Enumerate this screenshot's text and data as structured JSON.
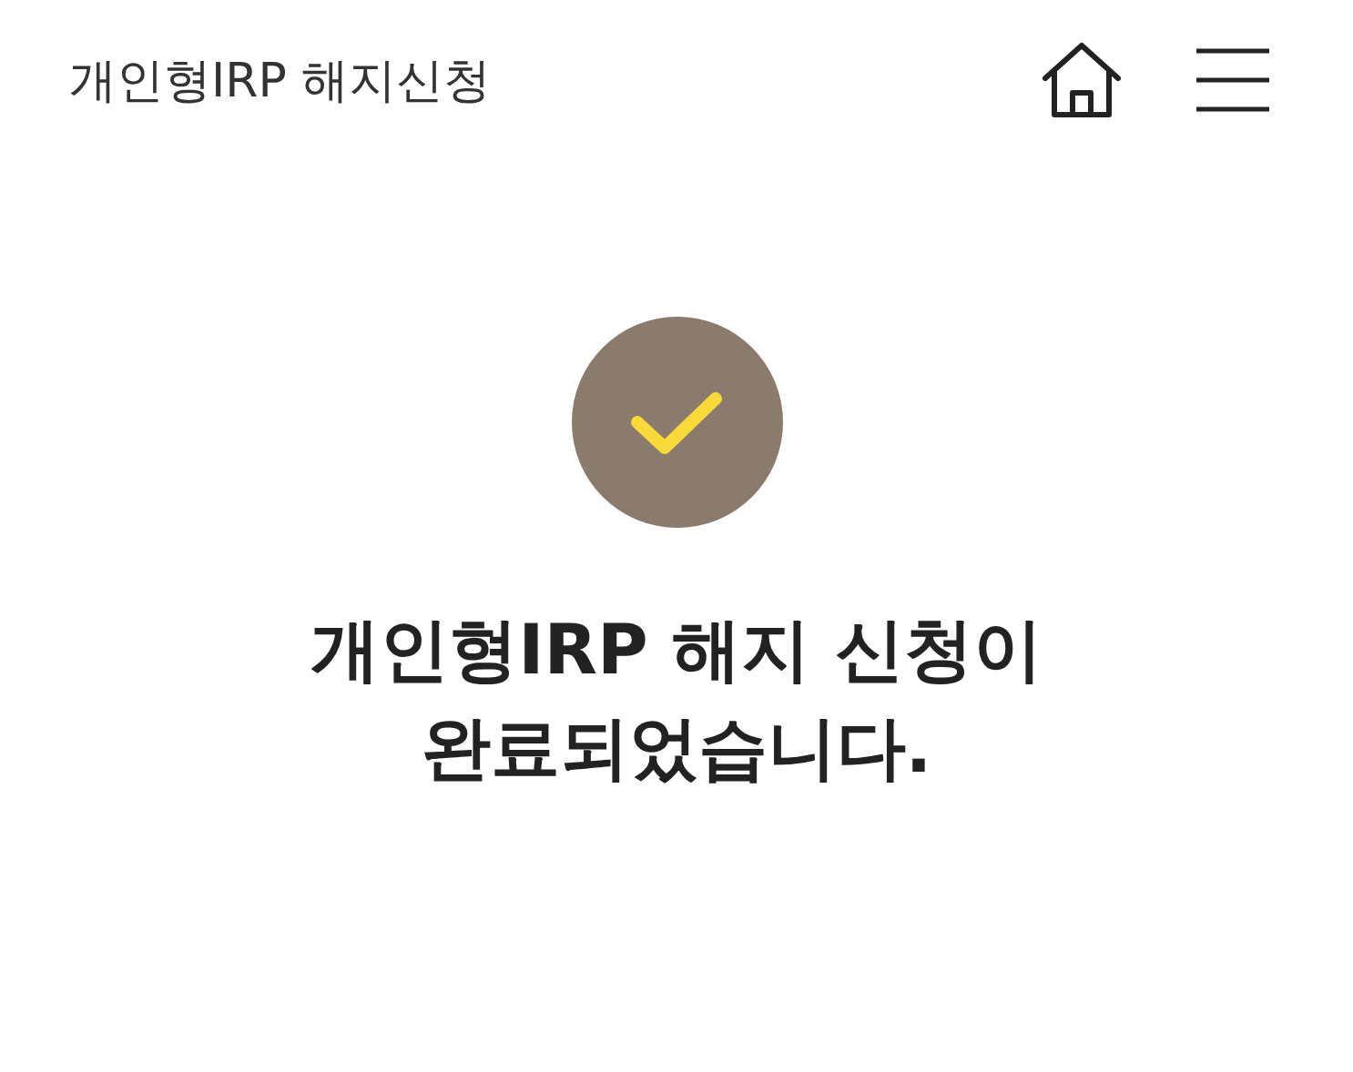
{
  "header": {
    "title": "개인형IRP 해지신청"
  },
  "result": {
    "completed": true,
    "message_lines": [
      "개인형IRP 해지 신청이",
      "완료되었습니다."
    ]
  }
}
